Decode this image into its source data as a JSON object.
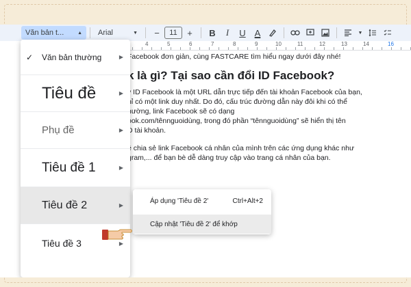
{
  "toolbar": {
    "style_select": "Văn bản t...",
    "font_select": "Arial",
    "minus": "−",
    "font_size": "11",
    "plus": "+",
    "bold": "B",
    "italic": "I",
    "underline": "U",
    "text_color": "A"
  },
  "ruler": {
    "marks": [
      "4",
      "5",
      "6",
      "7",
      "8",
      "9",
      "10",
      "11",
      "12",
      "13",
      "14",
      "16"
    ]
  },
  "menu": {
    "items": [
      {
        "label": "Văn bản thường",
        "checked": true
      },
      {
        "label": "Tiêu đề"
      },
      {
        "label": "Phụ đề"
      },
      {
        "label": "Tiêu đề 1"
      },
      {
        "label": "Tiêu đề 2"
      },
      {
        "label": "Tiêu đề 3"
      }
    ]
  },
  "submenu": {
    "apply_label": "Áp dụng 'Tiêu đề 2'",
    "apply_shortcut": "Ctrl+Alt+2",
    "update_label": "Cập nhật 'Tiêu đề 2' để khớp"
  },
  "doc": {
    "line_top": "Facebook đơn giản, cùng FASTCARE tìm hiểu ngay dưới đây nhé!",
    "heading": "k là gì? Tại sao cần đổi ID Facebook?",
    "para1": [
      "y ID Facebook là một URL dẫn trực tiếp đến tài khoản Facebook của bạn,",
      "hỉ có một link duy nhất. Do đó, cấu trúc đường dẫn này đôi khi có thể",
      "hường, link Facebook sẽ có dạng",
      "ook.com/tênnguoidùng, trong đó phần “tênnguoidùng” sẽ hiển thị tên",
      "D tài khoản."
    ],
    "para2": [
      "ề chia sẻ link Facebook cá nhân của mình trên các ứng dụng khác như",
      "gram,... để bạn bè dễ dàng truy cập vào trang cá nhân của bạn."
    ]
  },
  "colors": {
    "accent": "#c2dbff",
    "toolbar_bg": "#edf2fa",
    "hover": "#e8e8e8",
    "frame_bg": "#f6ecd8"
  }
}
